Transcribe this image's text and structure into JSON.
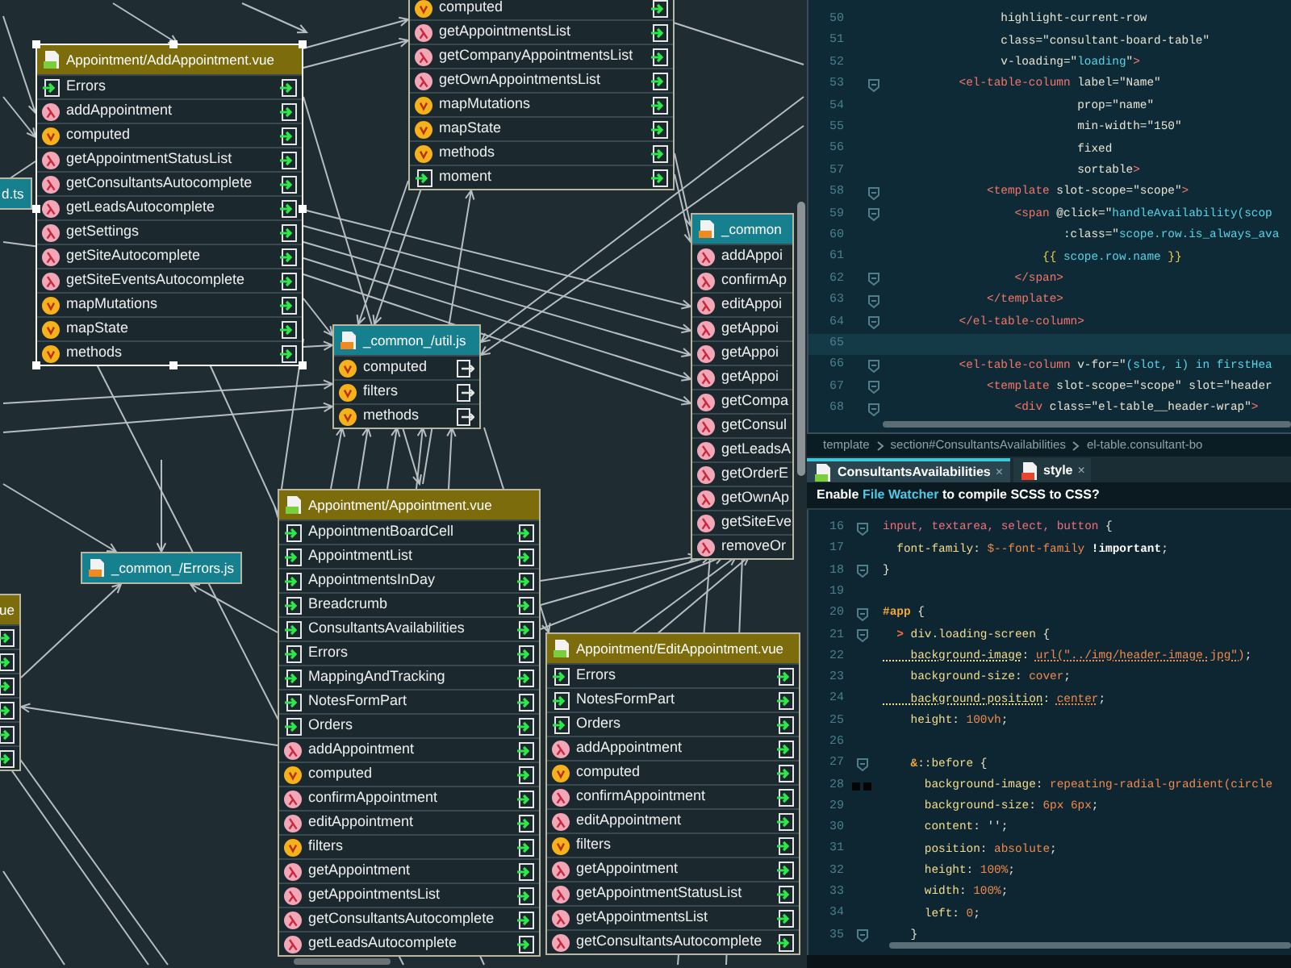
{
  "diagram": {
    "nodes": [
      {
        "kind": "vue",
        "selected": false,
        "items": [
          {
            "name": "computed",
            "kind": "property"
          },
          {
            "name": "getAppointmentsList",
            "kind": "method"
          },
          {
            "name": "getCompanyAppointmentsList",
            "kind": "method"
          },
          {
            "name": "getOwnAppointmentsList",
            "kind": "method"
          },
          {
            "name": "mapMutations",
            "kind": "property"
          },
          {
            "name": "mapState",
            "kind": "property"
          },
          {
            "name": "methods",
            "kind": "property"
          },
          {
            "name": "moment",
            "kind": "component"
          }
        ]
      },
      {
        "title": "Appointment/AddAppointment.vue",
        "kind": "vue",
        "selected": true,
        "items": [
          {
            "name": "Errors",
            "kind": "component"
          },
          {
            "name": "addAppointment",
            "kind": "method"
          },
          {
            "name": "computed",
            "kind": "property"
          },
          {
            "name": "getAppointmentStatusList",
            "kind": "method"
          },
          {
            "name": "getConsultantsAutocomplete",
            "kind": "method"
          },
          {
            "name": "getLeadsAutocomplete",
            "kind": "method"
          },
          {
            "name": "getSettings",
            "kind": "method"
          },
          {
            "name": "getSiteAutocomplete",
            "kind": "method"
          },
          {
            "name": "getSiteEventsAutocomplete",
            "kind": "method"
          },
          {
            "name": "mapMutations",
            "kind": "property"
          },
          {
            "name": "mapState",
            "kind": "property"
          },
          {
            "name": "methods",
            "kind": "property"
          }
        ]
      },
      {
        "title": "d.ts",
        "kind": "js",
        "selected": false
      },
      {
        "title": "_common_/util.js",
        "kind": "js",
        "selected": false,
        "items": [
          {
            "name": "computed",
            "kind": "property"
          },
          {
            "name": "filters",
            "kind": "property"
          },
          {
            "name": "methods",
            "kind": "property"
          }
        ]
      },
      {
        "title": "_common",
        "kind": "js",
        "selected": false,
        "items": [
          {
            "name": "addAppoi",
            "kind": "method"
          },
          {
            "name": "confirmAp",
            "kind": "method"
          },
          {
            "name": "editAppoi",
            "kind": "method"
          },
          {
            "name": "getAppoi",
            "kind": "method"
          },
          {
            "name": "getAppoi",
            "kind": "method"
          },
          {
            "name": "getAppoi",
            "kind": "method"
          },
          {
            "name": "getCompa",
            "kind": "method"
          },
          {
            "name": "getConsul",
            "kind": "method"
          },
          {
            "name": "getLeadsA",
            "kind": "method"
          },
          {
            "name": "getOrderE",
            "kind": "method"
          },
          {
            "name": "getOwnAp",
            "kind": "method"
          },
          {
            "name": "getSiteEve",
            "kind": "method"
          },
          {
            "name": "removeOr",
            "kind": "method"
          }
        ]
      },
      {
        "title": "_common_/Errors.js",
        "kind": "js",
        "selected": false
      },
      {
        "title": "ue",
        "kind": "vue",
        "selected": false,
        "items": [
          {
            "kind": "component"
          },
          {
            "kind": "component"
          },
          {
            "kind": "component"
          },
          {
            "kind": "component"
          },
          {
            "kind": "component"
          },
          {
            "kind": "component"
          }
        ]
      },
      {
        "title": "Appointment/Appointment.vue",
        "kind": "vue",
        "selected": false,
        "items": [
          {
            "name": "AppointmentBoardCell",
            "kind": "component"
          },
          {
            "name": "AppointmentList",
            "kind": "component"
          },
          {
            "name": "AppointmentsInDay",
            "kind": "component"
          },
          {
            "name": "Breadcrumb",
            "kind": "component"
          },
          {
            "name": "ConsultantsAvailabilities",
            "kind": "component"
          },
          {
            "name": "Errors",
            "kind": "component"
          },
          {
            "name": "MappingAndTracking",
            "kind": "component"
          },
          {
            "name": "NotesFormPart",
            "kind": "component"
          },
          {
            "name": "Orders",
            "kind": "component"
          },
          {
            "name": "addAppointment",
            "kind": "method"
          },
          {
            "name": "computed",
            "kind": "property"
          },
          {
            "name": "confirmAppointment",
            "kind": "method"
          },
          {
            "name": "editAppointment",
            "kind": "method"
          },
          {
            "name": "filters",
            "kind": "property"
          },
          {
            "name": "getAppointment",
            "kind": "method"
          },
          {
            "name": "getAppointmentsList",
            "kind": "method"
          },
          {
            "name": "getConsultantsAutocomplete",
            "kind": "method"
          },
          {
            "name": "getLeadsAutocomplete",
            "kind": "method"
          }
        ]
      },
      {
        "title": "Appointment/EditAppointment.vue",
        "kind": "vue",
        "selected": false,
        "items": [
          {
            "name": "Errors",
            "kind": "component"
          },
          {
            "name": "NotesFormPart",
            "kind": "component"
          },
          {
            "name": "Orders",
            "kind": "component"
          },
          {
            "name": "addAppointment",
            "kind": "method"
          },
          {
            "name": "computed",
            "kind": "property"
          },
          {
            "name": "confirmAppointment",
            "kind": "method"
          },
          {
            "name": "editAppointment",
            "kind": "method"
          },
          {
            "name": "filters",
            "kind": "property"
          },
          {
            "name": "getAppointment",
            "kind": "method"
          },
          {
            "name": "getAppointmentStatusList",
            "kind": "method"
          },
          {
            "name": "getAppointmentsList",
            "kind": "method"
          },
          {
            "name": "getConsultantsAutocomplete",
            "kind": "method"
          }
        ]
      }
    ]
  },
  "editor_top": {
    "lines": [
      {
        "number": "50",
        "fold": false,
        "current": false,
        "tokens": [
          {
            "kind": "attr",
            "text": "          highlight-current-row"
          }
        ]
      },
      {
        "number": "51",
        "fold": false,
        "current": false,
        "tokens": [
          {
            "kind": "attr",
            "text": "          class="
          },
          {
            "kind": "str",
            "text": "\"consultant-board-table\""
          }
        ]
      },
      {
        "number": "52",
        "fold": false,
        "current": false,
        "tokens": [
          {
            "kind": "attr",
            "text": "          v-loading=\""
          },
          {
            "kind": "expr",
            "text": "loading"
          },
          {
            "kind": "attr",
            "text": "\""
          },
          {
            "kind": "tag",
            "text": ">"
          }
        ]
      },
      {
        "number": "53",
        "fold": true,
        "current": false,
        "tokens": [
          {
            "kind": "tag",
            "text": "    <el-table-column"
          },
          {
            "kind": "attr",
            "text": " label=\"Name\""
          }
        ]
      },
      {
        "number": "54",
        "fold": false,
        "current": false,
        "tokens": [
          {
            "kind": "attr",
            "text": "                     prop=\"name\""
          }
        ]
      },
      {
        "number": "55",
        "fold": false,
        "current": false,
        "tokens": [
          {
            "kind": "attr",
            "text": "                     min-width=\"150\""
          }
        ]
      },
      {
        "number": "56",
        "fold": false,
        "current": false,
        "tokens": [
          {
            "kind": "attr",
            "text": "                     fixed"
          }
        ]
      },
      {
        "number": "57",
        "fold": false,
        "current": false,
        "tokens": [
          {
            "kind": "attr",
            "text": "                     sortable"
          },
          {
            "kind": "tag",
            "text": ">"
          }
        ]
      },
      {
        "number": "58",
        "fold": true,
        "current": false,
        "tokens": [
          {
            "kind": "tag",
            "text": "        <template"
          },
          {
            "kind": "attr",
            "text": " slot-scope=\"scope\""
          },
          {
            "kind": "tag",
            "text": ">"
          }
        ]
      },
      {
        "number": "59",
        "fold": true,
        "current": false,
        "tokens": [
          {
            "kind": "tag",
            "text": "            <span"
          },
          {
            "kind": "attr",
            "text": " @click=\""
          },
          {
            "kind": "expr",
            "text": "handleAvailability(scop"
          }
        ]
      },
      {
        "number": "60",
        "fold": false,
        "current": false,
        "tokens": [
          {
            "kind": "attr",
            "text": "                   :class=\""
          },
          {
            "kind": "expr",
            "text": "scope.row.is_always_ava"
          }
        ]
      },
      {
        "number": "61",
        "fold": false,
        "current": false,
        "tokens": [
          {
            "kind": "brace",
            "text": "                {{"
          },
          {
            "kind": "expr",
            "text": " scope.row.name "
          },
          {
            "kind": "brace",
            "text": "}}"
          }
        ]
      },
      {
        "number": "62",
        "fold": true,
        "current": false,
        "tokens": [
          {
            "kind": "tag",
            "text": "            </span>"
          }
        ]
      },
      {
        "number": "63",
        "fold": true,
        "current": false,
        "tokens": [
          {
            "kind": "tag",
            "text": "        </template>"
          }
        ]
      },
      {
        "number": "64",
        "fold": true,
        "current": false,
        "tokens": [
          {
            "kind": "tag",
            "text": "    </el-table-column>"
          }
        ]
      },
      {
        "number": "65",
        "fold": false,
        "current": true
      },
      {
        "number": "66",
        "fold": true,
        "current": false,
        "tokens": [
          {
            "kind": "tag",
            "text": "    <el-table-column"
          },
          {
            "kind": "attr",
            "text": " v-for=\""
          },
          {
            "kind": "expr",
            "text": "(slot, i) in firstHea"
          }
        ]
      },
      {
        "number": "67",
        "fold": true,
        "current": false,
        "tokens": [
          {
            "kind": "tag",
            "text": "        <template"
          },
          {
            "kind": "attr",
            "text": " slot-scope=\"scope\" slot=\"header"
          }
        ]
      },
      {
        "number": "68",
        "fold": true,
        "current": false,
        "tokens": [
          {
            "kind": "tag",
            "text": "            <div"
          },
          {
            "kind": "attr",
            "text": " class=\"el-table__header-wrap\""
          },
          {
            "kind": "tag",
            "text": ">"
          }
        ]
      }
    ]
  },
  "breadcrumb": [
    "template",
    "section#ConsultantsAvailabilities",
    "el-table.consultant-bo"
  ],
  "tabs": [
    {
      "label": "ConsultantsAvailabilities",
      "kind": "vue",
      "selected": true,
      "close": "×"
    },
    {
      "label": "style",
      "kind": "style",
      "selected": false,
      "close": "×"
    }
  ],
  "notice": {
    "before": "Enable",
    "link": "File Watcher",
    "after": "to compile SCSS to CSS?"
  },
  "editor_bottom": {
    "lines": [
      {
        "number": "16",
        "fold": true,
        "swatch": false,
        "tokens": [
          {
            "kind": "sel",
            "text": "input, textarea, select, button"
          },
          {
            "kind": "punc",
            "text": " {"
          }
        ]
      },
      {
        "number": "17",
        "fold": false,
        "swatch": false,
        "tokens": [
          {
            "kind": "prop",
            "text": "  font-family"
          },
          {
            "kind": "punc",
            "text": ": "
          },
          {
            "kind": "val",
            "text": "$--font-family"
          },
          {
            "kind": "imp",
            "text": " !important"
          },
          {
            "kind": "punc",
            "text": ";"
          }
        ]
      },
      {
        "number": "18",
        "fold": true,
        "swatch": false,
        "tokens": [
          {
            "kind": "punc",
            "text": "}"
          }
        ]
      },
      {
        "number": "19",
        "fold": false,
        "swatch": false
      },
      {
        "number": "20",
        "fold": true,
        "swatch": false,
        "tokens": [
          {
            "kind": "id",
            "text": "#app"
          },
          {
            "kind": "punc",
            "text": " {"
          }
        ]
      },
      {
        "number": "21",
        "fold": true,
        "swatch": false,
        "tokens": [
          {
            "kind": "marker",
            "text": "  >"
          },
          {
            "kind": "prop",
            "text": " div.loading-screen"
          },
          {
            "kind": "punc",
            "text": " {"
          }
        ]
      },
      {
        "number": "22",
        "fold": false,
        "swatch": false,
        "tokens": [
          {
            "kind": "prop-warn",
            "text": "    background-image"
          },
          {
            "kind": "punc",
            "text": ": "
          },
          {
            "kind": "val-warn",
            "text": "url(\"../img/header-image.jpg\")"
          },
          {
            "kind": "punc",
            "text": ";"
          }
        ]
      },
      {
        "number": "23",
        "fold": false,
        "swatch": false,
        "tokens": [
          {
            "kind": "prop",
            "text": "    background-size"
          },
          {
            "kind": "punc",
            "text": ": "
          },
          {
            "kind": "val",
            "text": "cover"
          },
          {
            "kind": "punc",
            "text": ";"
          }
        ]
      },
      {
        "number": "24",
        "fold": false,
        "swatch": false,
        "tokens": [
          {
            "kind": "prop-warn",
            "text": "    background-position"
          },
          {
            "kind": "punc",
            "text": ": "
          },
          {
            "kind": "val-warn",
            "text": "center"
          },
          {
            "kind": "punc",
            "text": ";"
          }
        ]
      },
      {
        "number": "25",
        "fold": false,
        "swatch": false,
        "tokens": [
          {
            "kind": "prop",
            "text": "    height"
          },
          {
            "kind": "punc",
            "text": ": "
          },
          {
            "kind": "val",
            "text": "100vh"
          },
          {
            "kind": "punc",
            "text": ";"
          }
        ]
      },
      {
        "number": "26",
        "fold": false,
        "swatch": false
      },
      {
        "number": "27",
        "fold": true,
        "swatch": false,
        "tokens": [
          {
            "kind": "id",
            "text": "    &"
          },
          {
            "kind": "prop",
            "text": "::before"
          },
          {
            "kind": "punc",
            "text": " {"
          }
        ]
      },
      {
        "number": "28",
        "fold": false,
        "swatch": true,
        "tokens": [
          {
            "kind": "prop",
            "text": "      background-image"
          },
          {
            "kind": "punc",
            "text": ": "
          },
          {
            "kind": "val",
            "text": "repeating-radial-gradient(circle"
          }
        ]
      },
      {
        "number": "29",
        "fold": false,
        "swatch": false,
        "tokens": [
          {
            "kind": "prop",
            "text": "      background-size"
          },
          {
            "kind": "punc",
            "text": ": "
          },
          {
            "kind": "val",
            "text": "6px 6px"
          },
          {
            "kind": "punc",
            "text": ";"
          }
        ]
      },
      {
        "number": "30",
        "fold": false,
        "swatch": false,
        "tokens": [
          {
            "kind": "prop",
            "text": "      content"
          },
          {
            "kind": "punc",
            "text": ": "
          },
          {
            "kind": "str",
            "text": "''"
          },
          {
            "kind": "punc",
            "text": ";"
          }
        ]
      },
      {
        "number": "31",
        "fold": false,
        "swatch": false,
        "tokens": [
          {
            "kind": "prop",
            "text": "      position"
          },
          {
            "kind": "punc",
            "text": ": "
          },
          {
            "kind": "val",
            "text": "absolute"
          },
          {
            "kind": "punc",
            "text": ";"
          }
        ]
      },
      {
        "number": "32",
        "fold": false,
        "swatch": false,
        "tokens": [
          {
            "kind": "prop",
            "text": "      height"
          },
          {
            "kind": "punc",
            "text": ": "
          },
          {
            "kind": "val",
            "text": "100%"
          },
          {
            "kind": "punc",
            "text": ";"
          }
        ]
      },
      {
        "number": "33",
        "fold": false,
        "swatch": false,
        "tokens": [
          {
            "kind": "prop",
            "text": "      width"
          },
          {
            "kind": "punc",
            "text": ": "
          },
          {
            "kind": "val",
            "text": "100%"
          },
          {
            "kind": "punc",
            "text": ";"
          }
        ]
      },
      {
        "number": "34",
        "fold": false,
        "swatch": false,
        "tokens": [
          {
            "kind": "prop",
            "text": "      left"
          },
          {
            "kind": "punc",
            "text": ": "
          },
          {
            "kind": "val",
            "text": "0"
          },
          {
            "kind": "punc",
            "text": ";"
          }
        ]
      },
      {
        "number": "35",
        "fold": true,
        "swatch": false,
        "tokens": [
          {
            "kind": "punc",
            "text": "    }"
          }
        ]
      }
    ]
  }
}
